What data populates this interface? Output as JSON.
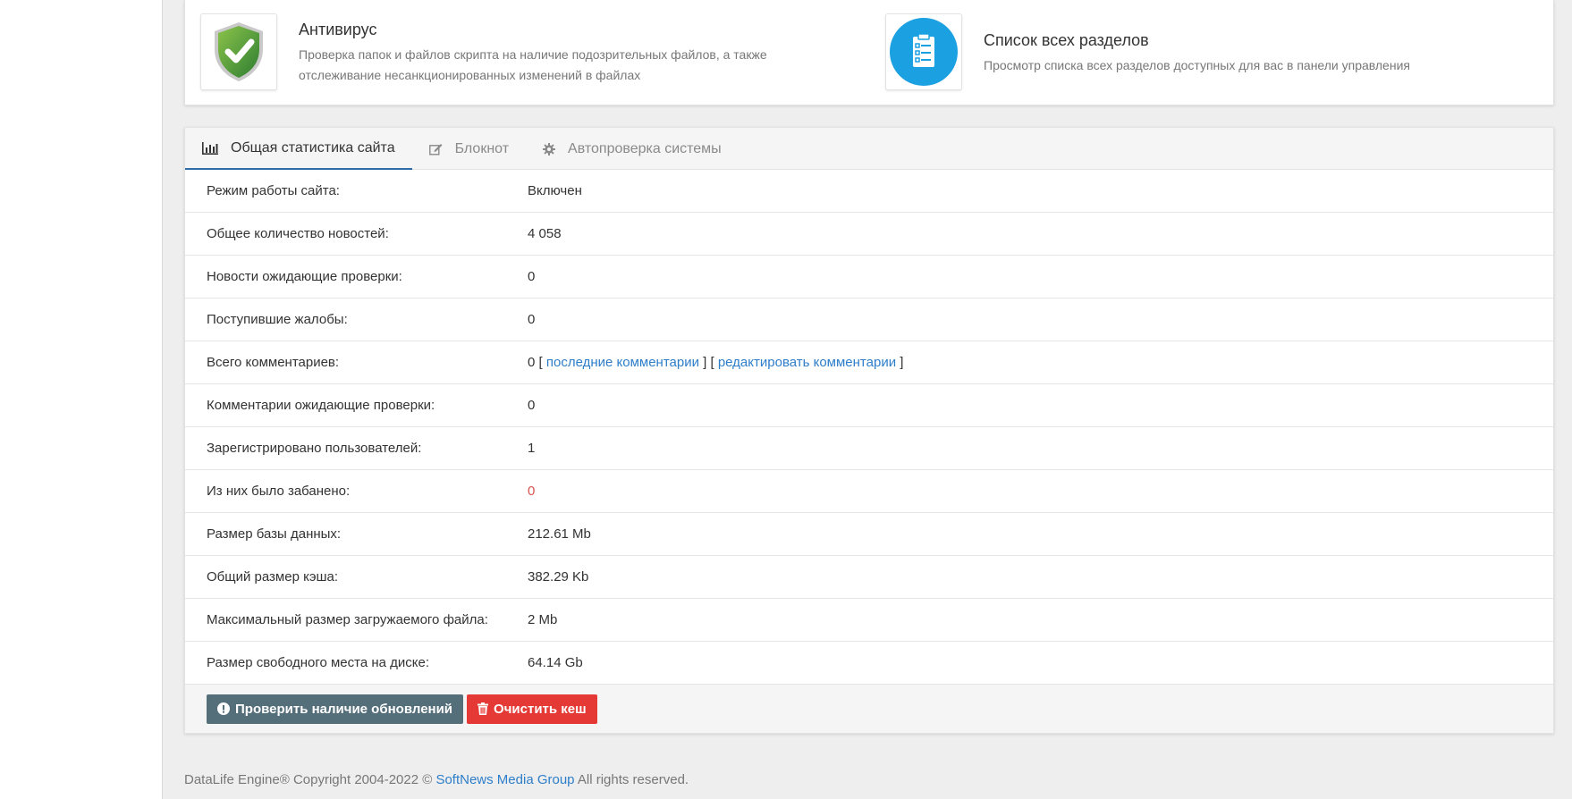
{
  "quick_panel": {
    "antivirus": {
      "title": "Антивирус",
      "description": "Проверка папок и файлов скрипта на наличие подозрительных файлов, а также отслеживание несанкционированных изменений в файлах",
      "icon": "shield-check-icon"
    },
    "sections": {
      "title": "Список всех разделов",
      "description": "Просмотр списка всех разделов доступных для вас в панели управления",
      "icon": "clipboard-list-icon"
    }
  },
  "tabs": [
    {
      "label": "Общая статистика сайта",
      "icon": "bar-chart-icon",
      "active": true
    },
    {
      "label": "Блокнот",
      "icon": "edit-icon",
      "active": false
    },
    {
      "label": "Автопроверка системы",
      "icon": "gear-icon",
      "active": false
    }
  ],
  "stats": {
    "site_mode": {
      "label": "Режим работы сайта:",
      "value": "Включен"
    },
    "news_total": {
      "label": "Общее количество новостей:",
      "value": "4 058"
    },
    "news_pending": {
      "label": "Новости ожидающие проверки:",
      "value": "0"
    },
    "complaints": {
      "label": "Поступившие жалобы:",
      "value": "0"
    },
    "comments_total": {
      "label": "Всего комментариев:",
      "value": "0",
      "sep_open": " [ ",
      "link_last": "последние комментарии",
      "sep_mid": " ] [ ",
      "link_edit": "редактировать комментарии",
      "sep_close": " ]"
    },
    "comments_pending": {
      "label": "Комментарии ожидающие проверки:",
      "value": "0"
    },
    "users_registered": {
      "label": "Зарегистрировано пользователей:",
      "value": "1"
    },
    "users_banned": {
      "label": "Из них было забанено:",
      "value": "0"
    },
    "db_size": {
      "label": "Размер базы данных:",
      "value": "212.61 Mb"
    },
    "cache_size": {
      "label": "Общий размер кэша:",
      "value": "382.29 Kb"
    },
    "max_upload": {
      "label": "Максимальный размер загружаемого файла:",
      "value": "2 Mb"
    },
    "disk_free": {
      "label": "Размер свободного места на диске:",
      "value": "64.14 Gb"
    }
  },
  "buttons": {
    "check_updates": "Проверить наличие обновлений",
    "clear_cache": "Очистить кеш"
  },
  "footer": {
    "prefix": "DataLife Engine® Copyright 2004-2022 © ",
    "link": "SoftNews Media Group",
    "suffix": " All rights reserved."
  },
  "colors": {
    "accent_link": "#2e7ec9",
    "danger": "#e53935",
    "button_gray": "#546e7a",
    "ban_value": "#d9534f",
    "antivirus_green": "#4caf50",
    "sections_blue": "#1ba1e2"
  }
}
